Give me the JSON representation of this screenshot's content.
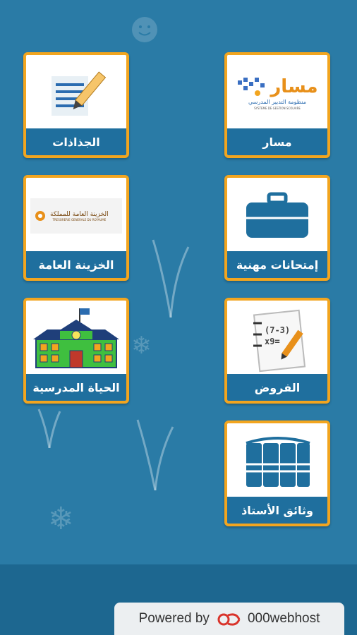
{
  "tiles": [
    {
      "label": "الجذاذات",
      "icon": "pen-document-icon"
    },
    {
      "label": "مسار",
      "icon": "massar-logo",
      "logo_title": "مسار",
      "logo_subtitle": "منظومة التدبير المدرسي",
      "logo_caption": "SYSTEME DE GESTION SCOLAIRE"
    },
    {
      "label": "الخزينة العامة",
      "icon": "treasury-logo",
      "logo_title": "الخزينة العامة للمملكة",
      "logo_caption": "TRESORERIE GENERALE DU ROYAUME"
    },
    {
      "label": "إمتحانات مهنية",
      "icon": "briefcase-icon"
    },
    {
      "label": "الحياة المدرسية",
      "icon": "school-building-icon"
    },
    {
      "label": "الفروض",
      "icon": "notebook-math-icon",
      "math_text": "(7-3) x9="
    },
    {
      "label": "وثائق الأستاذ",
      "icon": "books-icon"
    }
  ],
  "footer": {
    "powered_by": "Powered by",
    "brand": "000webhost",
    "logo_icon": "000webhost-logo-icon"
  },
  "colors": {
    "background": "#2a7ba6",
    "tile_border": "#f2a51f",
    "label_bar": "#1f6f9e",
    "footer": "#1d6790"
  }
}
